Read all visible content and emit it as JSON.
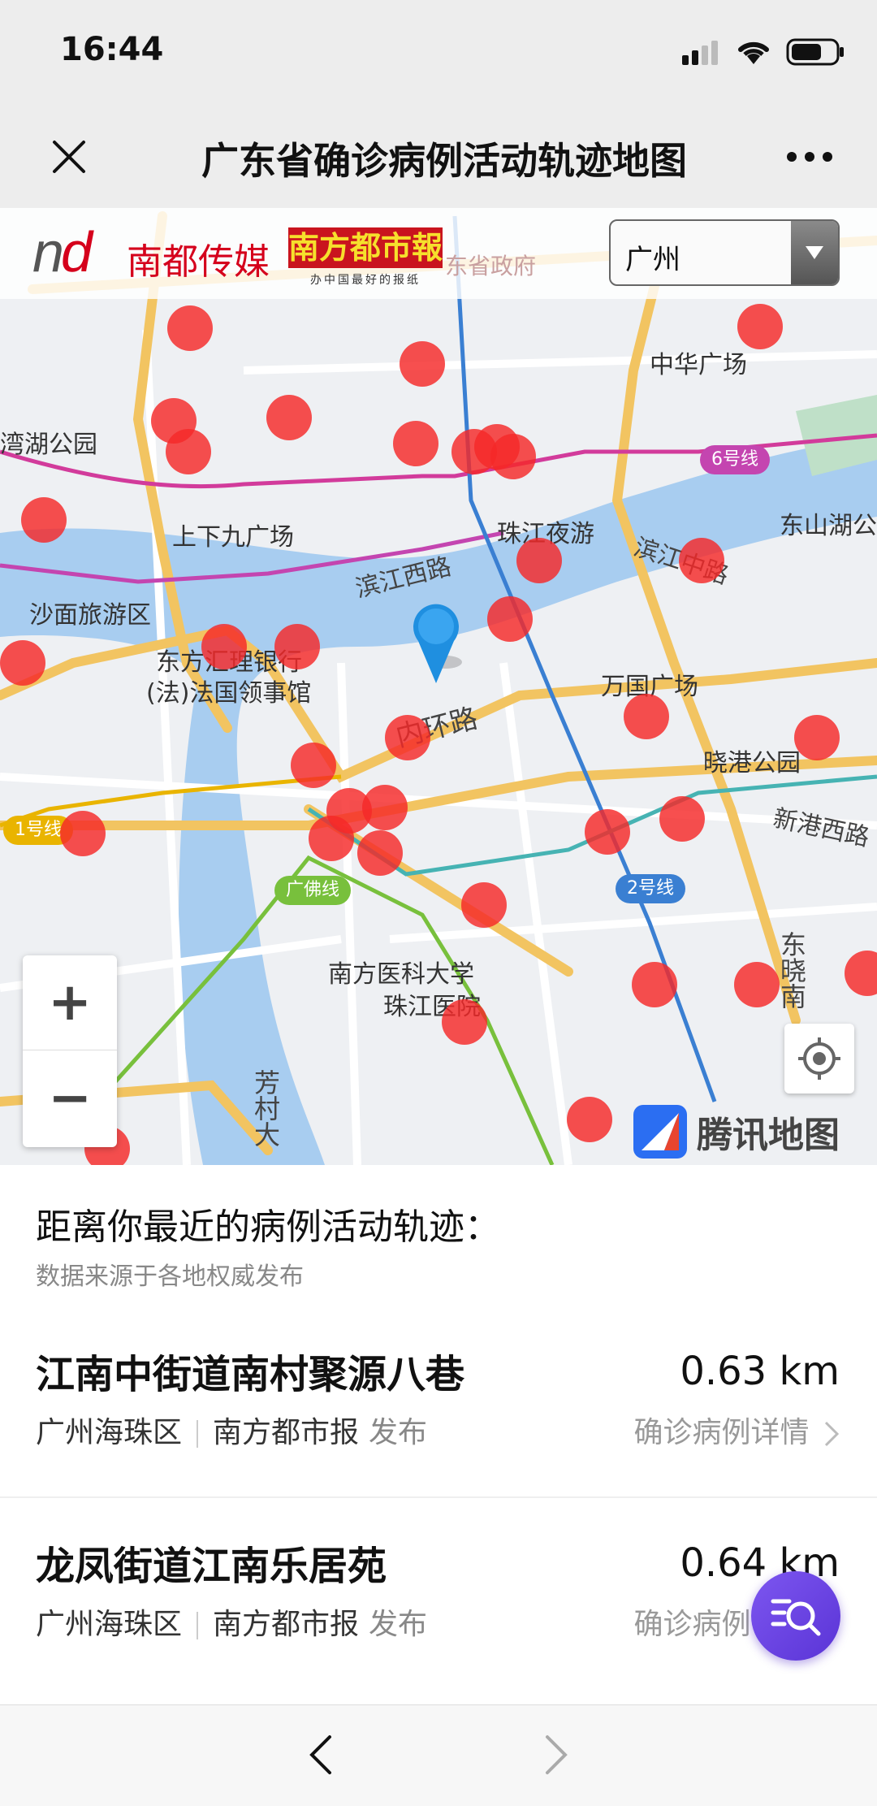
{
  "status_bar": {
    "time": "16:44",
    "icons": [
      "signal-icon",
      "wifi-icon",
      "battery-icon"
    ]
  },
  "nav": {
    "title": "广东省确诊病例活动轨迹地图"
  },
  "map": {
    "brand_nd": "nd",
    "brand_media": "南都传媒",
    "brand_paper": "南方都市報",
    "brand_slogan": "办中国最好的报纸",
    "city_select": {
      "value": "广州"
    },
    "labels": {
      "zhonghua": "中华广场",
      "lihu": "湾湖公园",
      "xiajiu": "上下九广场",
      "zhujiang_night": "珠江夜游",
      "dongshan": "东山湖公",
      "binjiang_xi": "滨江西路",
      "binjiang_zhong": "滨江中路",
      "shamian": "沙面旅游区",
      "dongfang_bank": "东方汇理银行",
      "french_consulate": "(法)法国领事馆",
      "wanguo": "万国广场",
      "neihuan": "内环路",
      "xiaogang": "晓港公园",
      "xingang": "新港西路",
      "nanfang_hospital_1": "南方医科大学",
      "nanfang_hospital_2": "珠江医院",
      "dongxiao": "东晓南",
      "fangcun": "芳村大",
      "gov": "东省政府"
    },
    "lines": {
      "line6": "6号线",
      "line1": "1号线",
      "guangfo": "广佛线",
      "line2": "2号线"
    },
    "zoom_in": "+",
    "zoom_out": "−",
    "provider": "腾讯地图",
    "colors": {
      "case_dot": "#f52828",
      "river": "#a8cdf0",
      "road_major": "#f2c461",
      "road_minor": "#ffffff"
    }
  },
  "list": {
    "title": "距离你最近的病例活动轨迹：",
    "subtitle": "数据来源于各地权威发布",
    "items": [
      {
        "name": "江南中街道南村聚源八巷",
        "distance": "0.63 km",
        "district": "广州海珠区",
        "source": "南方都市报",
        "published": "发布",
        "detail": "确诊病例详情"
      },
      {
        "name": "龙凤街道江南乐居苑",
        "distance": "0.64 km",
        "district": "广州海珠区",
        "source": "南方都市报",
        "published": "发布",
        "detail": "确诊病例详情"
      }
    ]
  },
  "bottom": {
    "back": "back",
    "forward": "forward"
  }
}
